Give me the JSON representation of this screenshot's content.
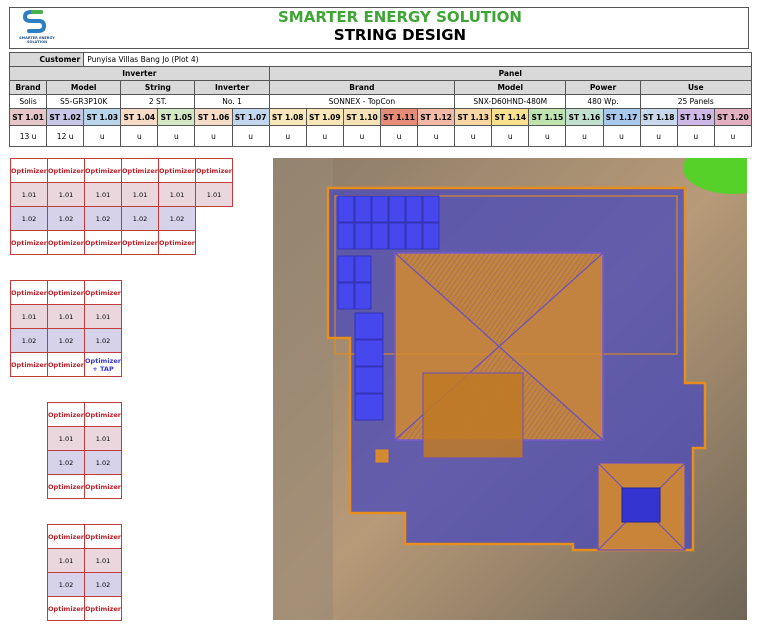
{
  "header": {
    "logo_text": "SMARTER ENERGY SOLUTION",
    "company": "SMARTER ENERGY SOLUTION",
    "title": "STRING DESIGN"
  },
  "customer": {
    "label": "Customer",
    "value": "Punyisa Villas Bang Jo (Plot 4)"
  },
  "sections": {
    "inverter": "Inverter",
    "panel": "Panel"
  },
  "headers": {
    "brand": "Brand",
    "model": "Model",
    "string": "String",
    "inverter": "Inverter",
    "panel_brand": "Brand",
    "panel_model": "Model",
    "power": "Power",
    "use": "Use"
  },
  "values": {
    "brand": "Solis",
    "model": "S5-GR3P10K",
    "string": "2 ST.",
    "inverter": "No. 1",
    "panel_brand": "SONNEX - TopCon",
    "panel_model": "SNX-D60HND-480M",
    "power": "480 Wp.",
    "use": "25 Panels"
  },
  "strings": [
    {
      "label": "ST 1.01",
      "count": "13 u",
      "color": "#e7c6c9"
    },
    {
      "label": "ST 1.02",
      "count": "12 u",
      "color": "#c8c6e6"
    },
    {
      "label": "ST 1.03",
      "count": "u",
      "color": "#b9d5ec"
    },
    {
      "label": "ST 1.04",
      "count": "u",
      "color": "#f6dbc7"
    },
    {
      "label": "ST 1.05",
      "count": "u",
      "color": "#d3e7c5"
    },
    {
      "label": "ST 1.06",
      "count": "u",
      "color": "#f4dcc6"
    },
    {
      "label": "ST 1.07",
      "count": "u",
      "color": "#c2d6ee"
    },
    {
      "label": "ST 1.08",
      "count": "u",
      "color": "#f8e8b9"
    },
    {
      "label": "ST 1.09",
      "count": "u",
      "color": "#f8e6b8"
    },
    {
      "label": "ST 1.10",
      "count": "u",
      "color": "#f6e2b7"
    },
    {
      "label": "ST 1.11",
      "count": "u",
      "color": "#e58b77"
    },
    {
      "label": "ST 1.12",
      "count": "u",
      "color": "#f1b9a6"
    },
    {
      "label": "ST 1.13",
      "count": "u",
      "color": "#f7d6a3"
    },
    {
      "label": "ST 1.14",
      "count": "u",
      "color": "#f9e08f"
    },
    {
      "label": "ST 1.15",
      "count": "u",
      "color": "#bfe3ae"
    },
    {
      "label": "ST 1.16",
      "count": "u",
      "color": "#c2e0d0"
    },
    {
      "label": "ST 1.17",
      "count": "u",
      "color": "#a8c8ec"
    },
    {
      "label": "ST 1.18",
      "count": "u",
      "color": "#c8d9ec"
    },
    {
      "label": "ST 1.19",
      "count": "u",
      "color": "#cdb8e6"
    },
    {
      "label": "ST 1.20",
      "count": "u",
      "color": "#e3b0c2"
    }
  ],
  "optimizer": {
    "label": "Optimizer",
    "tap": "Optimizer + TAP",
    "v1": "1.01",
    "v2": "1.02"
  }
}
